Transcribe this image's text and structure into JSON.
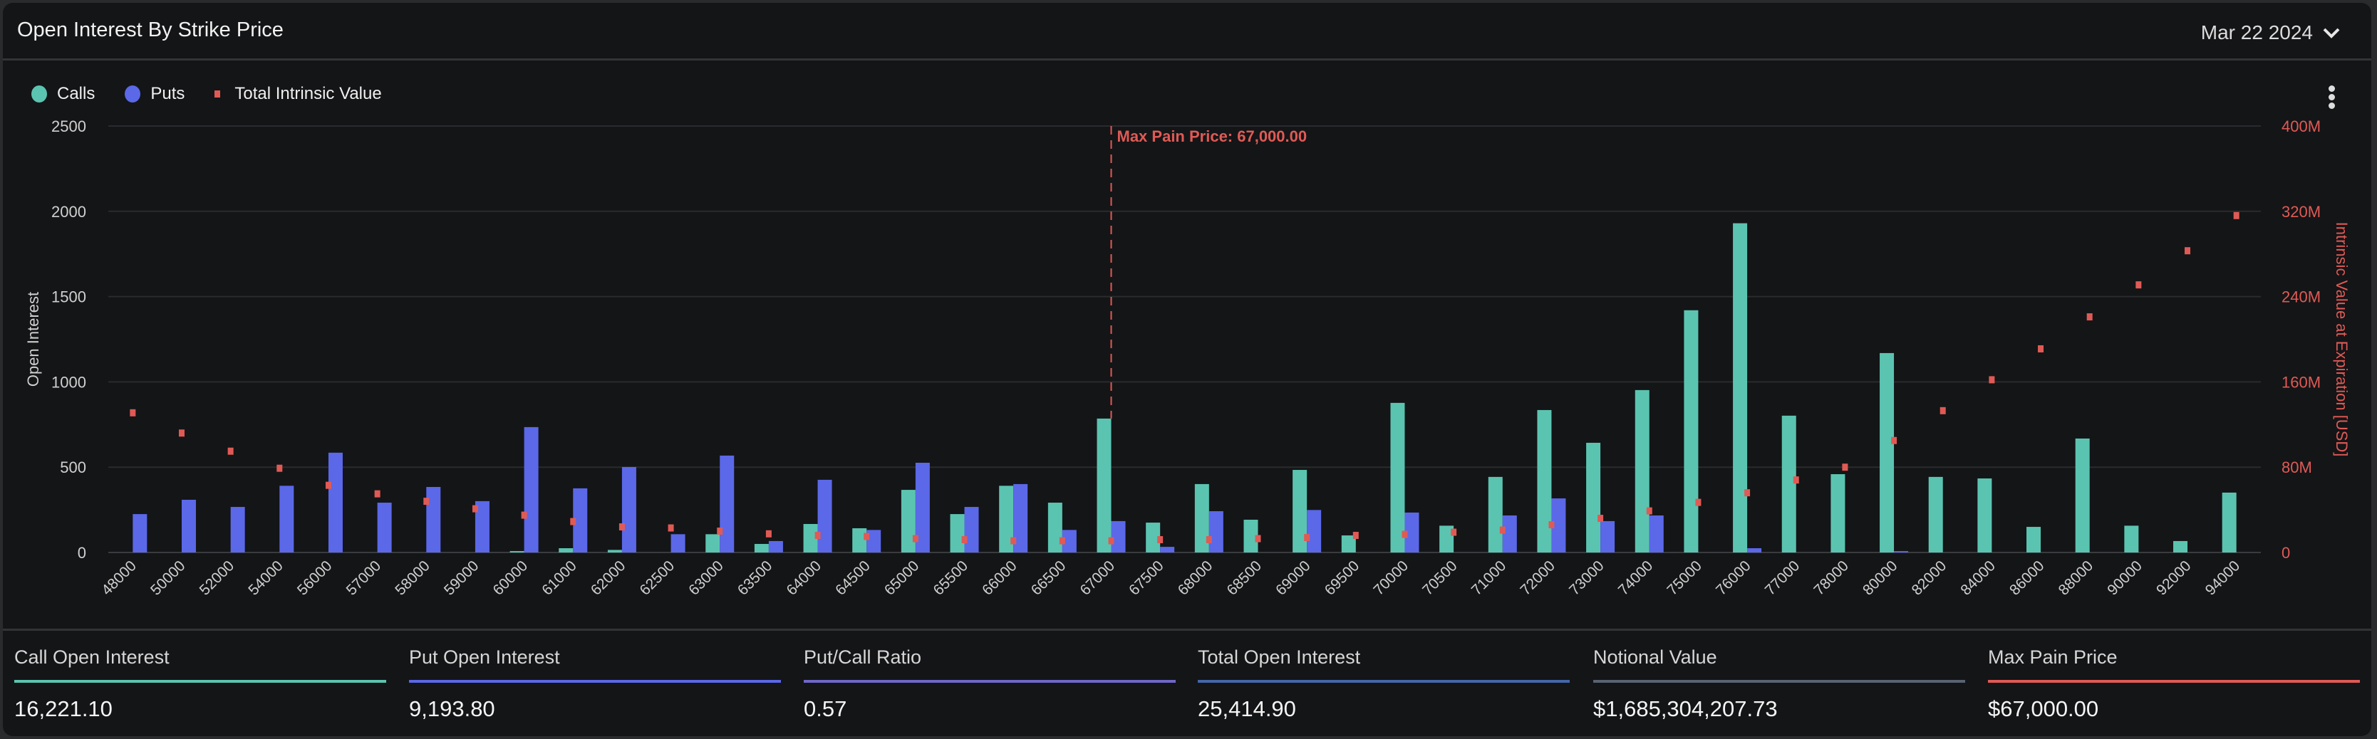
{
  "header": {
    "title": "Open Interest By Strike Price",
    "date": "Mar 22 2024"
  },
  "colors": {
    "calls": "#5bc4b0",
    "puts": "#5b68e8",
    "intrinsic": "#e05a55",
    "ratio": "#7067c8",
    "total": "#4466aa",
    "notional": "#5a6273"
  },
  "legend": {
    "calls": "Calls",
    "puts": "Puts",
    "intrinsic": "Total Intrinsic Value"
  },
  "chart_data": {
    "type": "bar",
    "ylabel": "Open Interest",
    "y2label": "Intrinsic Value at Expiration [USD]",
    "ylim": [
      0,
      2500
    ],
    "y2lim": [
      0,
      400
    ],
    "yticks": [
      "0",
      "500",
      "1000",
      "1500",
      "2000",
      "2500"
    ],
    "y2ticks": [
      "0",
      "80M",
      "160M",
      "240M",
      "320M",
      "400M"
    ],
    "grid": true,
    "legend_position": "top-left",
    "annotation": {
      "label": "Max Pain Price: 67,000.00",
      "x": "67000"
    },
    "categories": [
      "48000",
      "50000",
      "52000",
      "54000",
      "56000",
      "57000",
      "58000",
      "59000",
      "60000",
      "61000",
      "62000",
      "62500",
      "63000",
      "63500",
      "64000",
      "64500",
      "65000",
      "65500",
      "66000",
      "66500",
      "67000",
      "67500",
      "68000",
      "68500",
      "69000",
      "69500",
      "70000",
      "70500",
      "71000",
      "72000",
      "73000",
      "74000",
      "75000",
      "76000",
      "77000",
      "78000",
      "80000",
      "82000",
      "84000",
      "86000",
      "88000",
      "90000",
      "92000",
      "94000"
    ],
    "series": [
      {
        "name": "Calls",
        "type": "bar",
        "axis": "left",
        "values": [
          0,
          0,
          0,
          0,
          0,
          0,
          0,
          0,
          8,
          25,
          15,
          0,
          107,
          50,
          167,
          142,
          367,
          225,
          391,
          292,
          785,
          175,
          401,
          192,
          484,
          100,
          877,
          157,
          443,
          835,
          643,
          952,
          1420,
          1930,
          802,
          459,
          1169,
          443,
          434,
          150,
          668,
          157,
          67,
          351
        ]
      },
      {
        "name": "Puts",
        "type": "bar",
        "axis": "left",
        "values": [
          225,
          309,
          267,
          391,
          585,
          292,
          384,
          301,
          735,
          376,
          501,
          107,
          568,
          67,
          426,
          132,
          526,
          267,
          401,
          132,
          184,
          33,
          242,
          0,
          249,
          0,
          234,
          0,
          217,
          317,
          184,
          217,
          0,
          25,
          0,
          0,
          8,
          0,
          0,
          0,
          0,
          0,
          0,
          0
        ]
      },
      {
        "name": "Total Intrinsic Value",
        "type": "scatter",
        "axis": "right",
        "unit": "M USD",
        "values": [
          131,
          112,
          95,
          79,
          63,
          55,
          48,
          41,
          35,
          29,
          24,
          23,
          20,
          17.5,
          16,
          15,
          13,
          12,
          11,
          11,
          11,
          12,
          12,
          13,
          14,
          16,
          17,
          19,
          21,
          26,
          32,
          39,
          47,
          56,
          68,
          80,
          105,
          133,
          162,
          191,
          221,
          251,
          283,
          316
        ]
      }
    ]
  },
  "stats": [
    {
      "label": "Call Open Interest",
      "value": "16,221.10",
      "color": "#5bc4b0"
    },
    {
      "label": "Put Open Interest",
      "value": "9,193.80",
      "color": "#5b68e8"
    },
    {
      "label": "Put/Call Ratio",
      "value": "0.57",
      "color": "#7067c8"
    },
    {
      "label": "Total Open Interest",
      "value": "25,414.90",
      "color": "#4466aa"
    },
    {
      "label": "Notional Value",
      "value": "$1,685,304,207.73",
      "color": "#5a6273"
    },
    {
      "label": "Max Pain Price",
      "value": "$67,000.00",
      "color": "#e05a55"
    }
  ]
}
